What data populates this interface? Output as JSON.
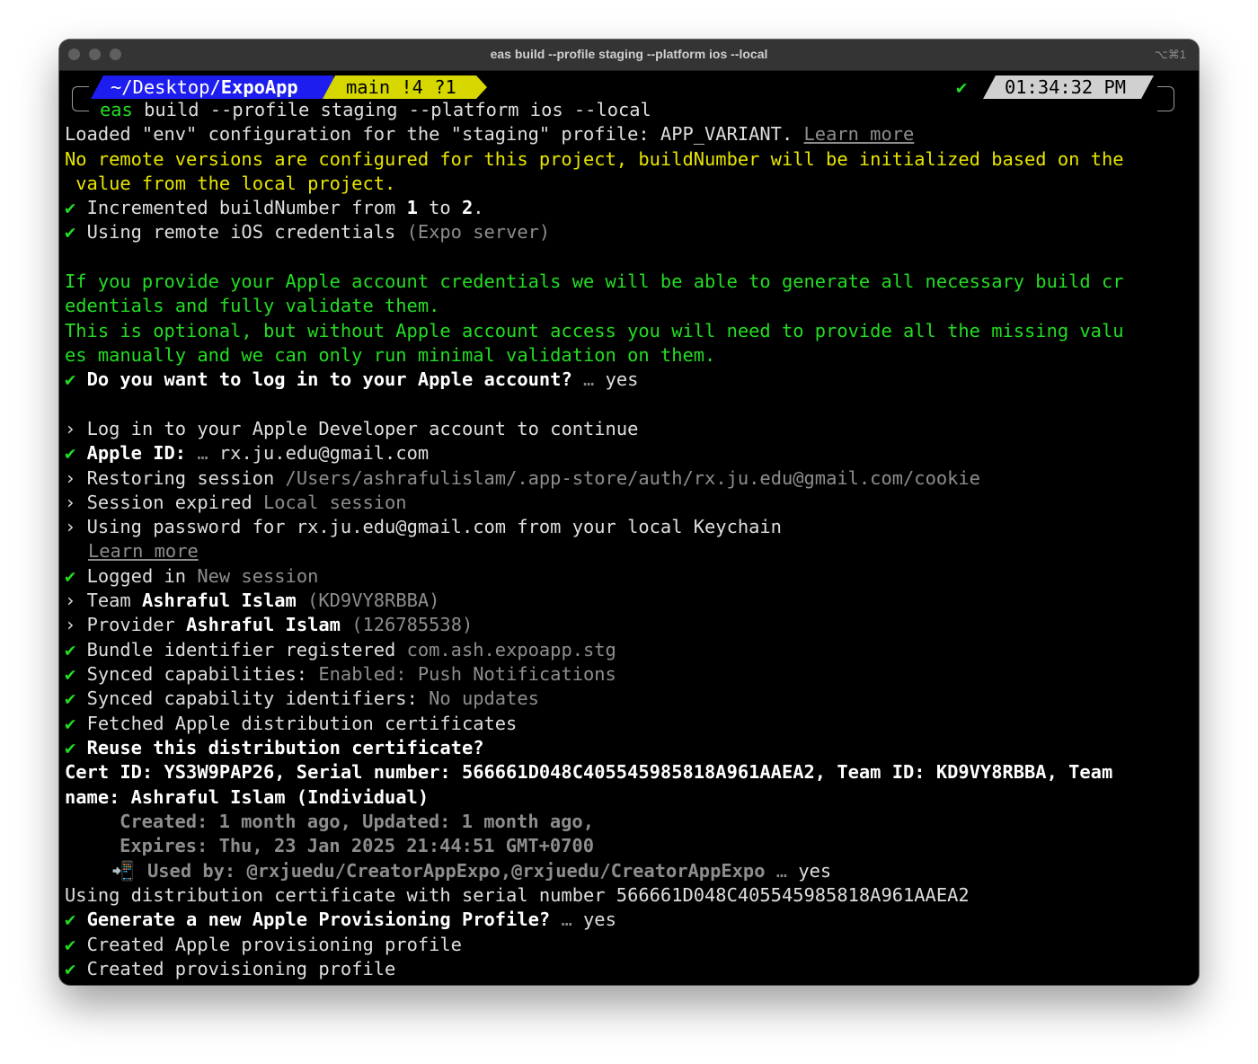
{
  "window": {
    "title": "eas build --profile staging --platform ios --local",
    "shortcut": "⌥⌘1"
  },
  "prompt": {
    "path_prefix": "~/Desktop/",
    "path_dir": "ExpoApp",
    "git": "main !4 ?1",
    "status_check": "✔",
    "time": "01:34:32 PM",
    "command_name": "eas",
    "command_args": " build --profile staging --platform ios --local"
  },
  "colors": {
    "green": "#24dc24",
    "yellow": "#e7e500",
    "dim": "#8d8d8d",
    "path_bg": "#1d1df0",
    "git_bg": "#d7d700",
    "time_bg": "#d0d0d0"
  },
  "lines": {
    "l01": "Loaded \"env\" configuration for the \"staging\" profile: APP_VARIANT. ",
    "l01_link": "Learn more",
    "l02": "No remote versions are configured for this project, buildNumber will be initialized based on the",
    "l03": " value from the local project.",
    "l04_a": "Incremented buildNumber from ",
    "l04_b": "1",
    "l04_c": " to ",
    "l04_d": "2",
    "l04_e": ".",
    "l05_a": "Using remote iOS credentials ",
    "l05_b": "(Expo server)",
    "l06": "If you provide your Apple account credentials we will be able to generate all necessary build cr",
    "l07": "edentials and fully validate them.",
    "l08": "This is optional, but without Apple account access you will need to provide all the missing valu",
    "l09": "es manually and we can only run minimal validation on them.",
    "l10_a": "Do you want to log in to your Apple account?",
    "l10_b": " … ",
    "l10_c": "yes",
    "l11": "Log in to your Apple Developer account to continue",
    "l12_a": "Apple ID:",
    "l12_b": " … ",
    "l12_c": "rx.ju.edu@gmail.com",
    "l13_a": "Restoring session ",
    "l13_b": "/Users/ashrafulislam/.app-store/auth/rx.ju.edu@gmail.com/cookie",
    "l14_a": "Session expired ",
    "l14_b": "Local session",
    "l15": "Using password for rx.ju.edu@gmail.com from your local Keychain",
    "l16_link": "Learn more",
    "l17_a": "Logged in ",
    "l17_b": "New session",
    "l18_a": "Team ",
    "l18_b": "Ashraful Islam",
    "l18_c": " (KD9VY8RBBA)",
    "l19_a": "Provider ",
    "l19_b": "Ashraful Islam",
    "l19_c": " (126785538)",
    "l20_a": "Bundle identifier registered ",
    "l20_b": "com.ash.expoapp.stg",
    "l21_a": "Synced capabilities: ",
    "l21_b": "Enabled: Push Notifications",
    "l22_a": "Synced capability identifiers: ",
    "l22_b": "No updates",
    "l23": "Fetched Apple distribution certificates",
    "l24": "Reuse this distribution certificate?",
    "l25": "Cert ID: YS3W9PAP26, Serial number: 566661D048C405545985818A961AAEA2, Team ID: KD9VY8RBBA, Team",
    "l26": "name: Ashraful Islam (Individual)",
    "l27": "    Created: 1 month ago, Updated: 1 month ago,",
    "l28": "    Expires: Thu, 23 Jan 2025 21:44:51 GMT+0700",
    "l29_icon": "📲",
    "l29_a": "Used by: @rxjuedu/CreatorAppExpo,@rxjuedu/CreatorAppExpo",
    "l29_b": " … ",
    "l29_c": "yes",
    "l30": "Using distribution certificate with serial number 566661D048C405545985818A961AAEA2",
    "l31_a": "Generate a new Apple Provisioning Profile?",
    "l31_b": " … ",
    "l31_c": "yes",
    "l32": "Created Apple provisioning profile",
    "l33": "Created provisioning profile"
  },
  "glyphs": {
    "check": "✔",
    "arrow": "›"
  }
}
